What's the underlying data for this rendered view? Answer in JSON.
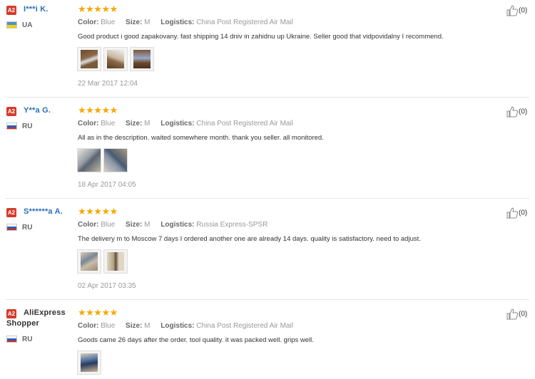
{
  "reviews": [
    {
      "badge": "A2",
      "name": "I***i K.",
      "country": "UA",
      "flag": [
        "#4a8fd6",
        "#f5d100"
      ],
      "color_label": "Color:",
      "color_value": "Blue",
      "size_label": "Size:",
      "size_value": "M",
      "logistics_label": "Logistics:",
      "logistics_value": "China Post Registered Air Mail",
      "text": "Good product i good zapakovany. fast shipping 14 dniv in zahidnu up Ukraine. Seller good that vidpovidalny I recommend.",
      "photo_count": 3,
      "date": "22 Mar 2017 12:04",
      "likes": "(0)",
      "stars": "★★★★★"
    },
    {
      "badge": "A2",
      "name": "Y**a G.",
      "country": "RU",
      "flag": [
        "#ffffff",
        "#2a5fb8",
        "#d62a2a"
      ],
      "color_label": "Color:",
      "color_value": "Blue",
      "size_label": "Size:",
      "size_value": "M",
      "logistics_label": "Logistics:",
      "logistics_value": "China Post Registered Air Mail",
      "text": "All as in the description. waited somewhere month. thank you seller. all monitored.",
      "photo_count": 2,
      "date": "18 Apr 2017 04:05",
      "likes": "(0)",
      "stars": "★★★★★"
    },
    {
      "badge": "A2",
      "name": "S******a A.",
      "country": "RU",
      "flag": [
        "#ffffff",
        "#2a5fb8",
        "#d62a2a"
      ],
      "color_label": "Color:",
      "color_value": "Blue",
      "size_label": "Size:",
      "size_value": "M",
      "logistics_label": "Logistics:",
      "logistics_value": "Russia Express-SPSR",
      "text": "The delivery m to Moscow 7 days I ordered another one are already 14 days. quality is satisfactory. need to adjust.",
      "photo_count": 2,
      "date": "02 Apr 2017 03:35",
      "likes": "(0)",
      "stars": "★★★★★"
    },
    {
      "badge": "A2",
      "name": "AliExpress Shopper",
      "country": "RU",
      "flag": [
        "#ffffff",
        "#2a5fb8",
        "#d62a2a"
      ],
      "color_label": "Color:",
      "color_value": "Blue",
      "size_label": "Size:",
      "size_value": "M",
      "logistics_label": "Logistics:",
      "logistics_value": "China Post Registered Air Mail",
      "text": "Goods came 26 days after the order. tool quality. it was packed well. grips well.",
      "photo_count": 1,
      "date": "",
      "likes": "(0)",
      "stars": "★★★★★"
    }
  ]
}
